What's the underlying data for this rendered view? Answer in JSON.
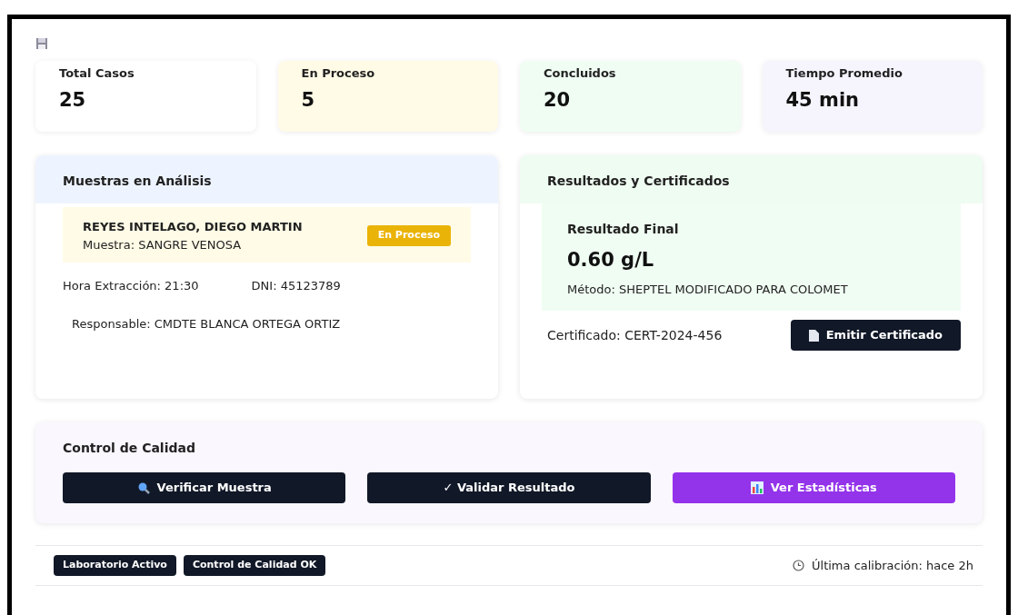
{
  "stats": [
    {
      "label": "Total Casos",
      "value": "25",
      "color": "#ffffff"
    },
    {
      "label": "En Proceso",
      "value": "5",
      "color": "#fffbe6"
    },
    {
      "label": "Concluidos",
      "value": "20",
      "color": "#effdf3"
    },
    {
      "label": "Tiempo Promedio",
      "value": "45 min",
      "color": "#f6f4fd"
    }
  ],
  "samples": {
    "title": "Muestras en Análisis",
    "name": "REYES INTELAGO, DIEGO MARTIN",
    "sample": "Muestra: SANGRE VENOSA",
    "status": "En Proceso",
    "hour": "Hora Extracción: 21:30",
    "dni": "DNI: 45123789",
    "responsible": "Responsable: CMDTE BLANCA ORTEGA ORTIZ"
  },
  "results": {
    "title": "Resultados y Certificados",
    "label": "Resultado Final",
    "value": "0.60 g/L",
    "method": "Método: SHEPTEL MODIFICADO PARA COLOMET",
    "certificate": "Certificado: CERT-2024-456",
    "button": "Emitir Certificado"
  },
  "quality": {
    "title": "Control de Calidad",
    "buttons": [
      {
        "label": "Verificar Muestra",
        "kind": "search"
      },
      {
        "label": "✓ Validar Resultado",
        "kind": "plain"
      },
      {
        "label": "Ver Estadísticas",
        "kind": "chart"
      }
    ]
  },
  "footer": {
    "badges": [
      "Laboratorio Activo",
      "Control de Calidad OK"
    ],
    "calibration": "Última calibración: hace 2h"
  }
}
